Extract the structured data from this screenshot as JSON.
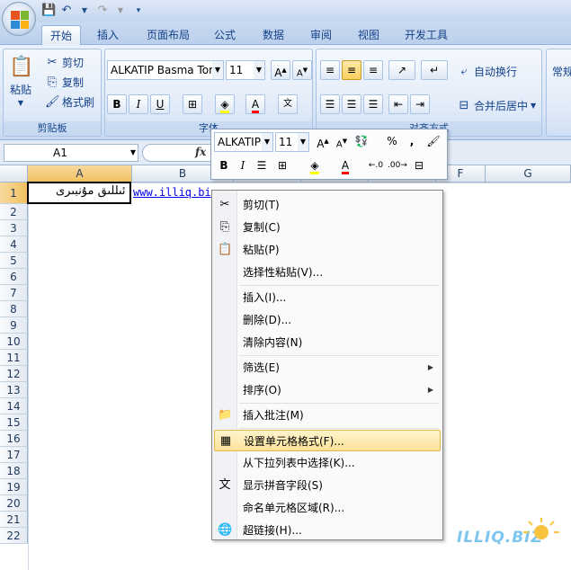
{
  "ribbon_tabs": [
    "开始",
    "插入",
    "页面布局",
    "公式",
    "数据",
    "审阅",
    "视图",
    "开发工具"
  ],
  "clipboard": {
    "paste": "粘贴",
    "cut": "剪切",
    "copy": "复制",
    "format_painter": "格式刷",
    "label": "剪贴板"
  },
  "font": {
    "name": "ALKATIP Basma Tor",
    "size": "11",
    "label": "字体"
  },
  "alignment": {
    "wrap_text": "自动换行",
    "merge_center": "合并后居中",
    "label": "对齐方式"
  },
  "number": {
    "format": "常规"
  },
  "formula_bar": {
    "cell_ref": "A1",
    "fx": "fx"
  },
  "columns": [
    "A",
    "B",
    "C",
    "D",
    "E",
    "F",
    "G"
  ],
  "rows": [
    "1",
    "2",
    "3",
    "4",
    "5",
    "6",
    "7",
    "8",
    "9",
    "10",
    "11",
    "12",
    "13",
    "14",
    "15",
    "16",
    "17",
    "18",
    "19",
    "20",
    "21",
    "22"
  ],
  "cells": {
    "A1": "ئىللىق مۇنبىرى",
    "B1": "www.illiq.bi"
  },
  "mini_toolbar": {
    "font": "ALKATIP",
    "size": "11",
    "percent": "%",
    "comma": ","
  },
  "context_menu": [
    {
      "label": "剪切(T)",
      "icon": "scissors-icon"
    },
    {
      "label": "复制(C)",
      "icon": "copy-icon"
    },
    {
      "label": "粘贴(P)",
      "icon": "paste-icon"
    },
    {
      "label": "选择性粘贴(V)..."
    },
    {
      "label": "插入(I)..."
    },
    {
      "label": "删除(D)..."
    },
    {
      "label": "清除内容(N)"
    },
    {
      "label": "筛选(E)",
      "submenu": true
    },
    {
      "label": "排序(O)",
      "submenu": true
    },
    {
      "label": "插入批注(M)",
      "icon": "comment-icon"
    },
    {
      "label": "设置单元格格式(F)...",
      "icon": "format-cells-icon",
      "highlighted": true
    },
    {
      "label": "从下拉列表中选择(K)..."
    },
    {
      "label": "显示拼音字段(S)",
      "icon": "phonetic-icon"
    },
    {
      "label": "命名单元格区域(R)..."
    },
    {
      "label": "超链接(H)...",
      "icon": "hyperlink-icon"
    }
  ],
  "watermark": "ILLIQ.BIZ",
  "colors": {
    "accent": "#15428b",
    "selected_header": "#f1c15f",
    "menu_highlight": "#fbe29a"
  }
}
